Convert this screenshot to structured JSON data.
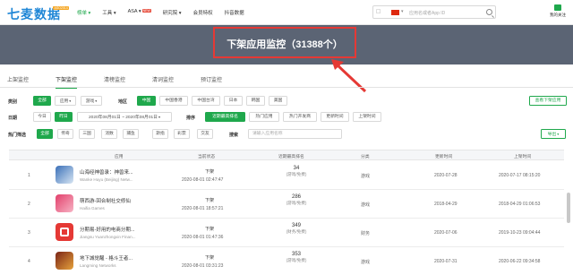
{
  "header": {
    "logo": "七麦数据",
    "logo_badge": "ASO2014",
    "nav": [
      {
        "label": "榜单 ▾",
        "active": true
      },
      {
        "label": "工具 ▾",
        "active": false
      },
      {
        "label": "ASA ▾",
        "active": false,
        "tag": "NEW"
      },
      {
        "label": "研究院 ▾",
        "active": false
      },
      {
        "label": "会员特权",
        "active": false
      },
      {
        "label": "抖音数据",
        "active": false
      }
    ],
    "search_placeholder": "应用名或者App ID",
    "follow_label": "我的关注"
  },
  "banner": {
    "title": "下架应用监控（31388个）"
  },
  "tabs": [
    "上架监控",
    "下架监控",
    "清榜监控",
    "清词监控",
    "预订监控"
  ],
  "filters": {
    "category_label": "类别",
    "category_all": "全部",
    "category_app": "应用",
    "category_game": "游戏",
    "region_label": "地区",
    "regions": [
      "中国",
      "中国香港",
      "中国台湾",
      "日本",
      "韩国",
      "美国"
    ],
    "view_delisted": "查看下架应用",
    "date_label": "日期",
    "date_today": "今日",
    "date_yesterday": "昨日",
    "date_range_start": "2020年08月01日",
    "date_range_end": "2020年08月01日",
    "sort_label": "排序",
    "sort_options": [
      "近期最高排名",
      "热门应用",
      "热门开发商",
      "更新时间",
      "上架时间"
    ],
    "hot_label": "热门筛选",
    "hot_options": [
      "全部",
      "传奇",
      "三国",
      "消数",
      "捕鱼",
      "斯指",
      "彩票",
      "交友"
    ],
    "search_label": "搜索",
    "search_placeholder": "请输入应用名称",
    "export": "导出"
  },
  "table": {
    "headers": [
      "应用",
      "当前状态",
      "近期最高排名",
      "分类",
      "更新时间",
      "上架时间"
    ],
    "rows": [
      {
        "idx": "1",
        "name": "山海经神兽录：神兽来...",
        "dev": "Wanke Huyu (Beijing) Netw...",
        "status": "下架",
        "status_time": "2020-08-01 02:47:47",
        "rank": "34",
        "rank_sub": "(游戏/免费)",
        "category": "游戏",
        "updated": "2020-07-28",
        "listed": "2020-07-17 08:15:20",
        "c1": "#3a6fb8",
        "c2": "#d8e6f3"
      },
      {
        "idx": "2",
        "name": "萌西游-回合制社交修仙",
        "dev": "Haifia Games",
        "status": "下架",
        "status_time": "2020-08-01 18:57:21",
        "rank": "286",
        "rank_sub": "(游戏/免费)",
        "category": "游戏",
        "updated": "2018-04-29",
        "listed": "2018-04-29 01:06:53",
        "c1": "#e23f6b",
        "c2": "#f7b3c4"
      },
      {
        "idx": "3",
        "name": "分期易-好用的电商分期...",
        "dev": "Jiangsu Yuanzhongxin Finan...",
        "status": "下架",
        "status_time": "2020-08-01 01:47:36",
        "rank": "349",
        "rank_sub": "(财务/免费)",
        "category": "财务",
        "updated": "2020-07-06",
        "listed": "2019-10-23 09:04:44",
        "c1": "#e53935",
        "c2": "#ffffff"
      },
      {
        "idx": "4",
        "name": "地下城觉醒 - 格斗王者...",
        "dev": "Langming Networks",
        "status": "下架",
        "status_time": "2020-08-01 03:31:23",
        "rank": "353",
        "rank_sub": "(游戏/免费)",
        "category": "游戏",
        "updated": "2020-07-31",
        "listed": "2020-06-22 09:34:58",
        "c1": "#7a2416",
        "c2": "#e6a23c"
      }
    ]
  }
}
